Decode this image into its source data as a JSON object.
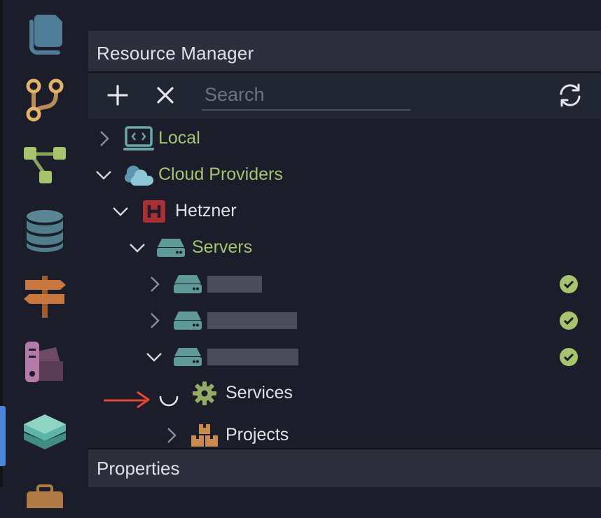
{
  "activity_bar": {
    "icons": [
      "documents-icon",
      "source-control-icon",
      "diagram-icon",
      "database-icon",
      "signpost-icon",
      "palette-icon",
      "layers-icon",
      "briefcase-icon"
    ]
  },
  "resource_manager": {
    "title": "Resource Manager",
    "search_placeholder": "Search",
    "toolbar_icons": [
      "plus-icon",
      "close-icon",
      "refresh-icon"
    ]
  },
  "tree": {
    "local": {
      "label": "Local",
      "expanded": false
    },
    "cloud_providers": {
      "label": "Cloud Providers",
      "expanded": true
    },
    "hetzner": {
      "label": "Hetzner",
      "expanded": true
    },
    "servers": {
      "label": "Servers",
      "expanded": true
    },
    "server_items": [
      {
        "label": "",
        "redacted": true,
        "expanded": false,
        "status": "ok"
      },
      {
        "label": "",
        "redacted": true,
        "expanded": false,
        "status": "ok"
      },
      {
        "label": "",
        "redacted": true,
        "expanded": true,
        "status": "ok"
      }
    ],
    "services": {
      "label": "Services",
      "loading": true
    },
    "projects": {
      "label": "Projects",
      "expanded": false
    }
  },
  "properties": {
    "title": "Properties"
  },
  "colors": {
    "accent_green": "#a7c46c",
    "status_ok": "#a7c46c",
    "hetzner_red": "#c0353a",
    "annotation_arrow": "#e8472e",
    "active_indicator": "#4a86d9"
  }
}
